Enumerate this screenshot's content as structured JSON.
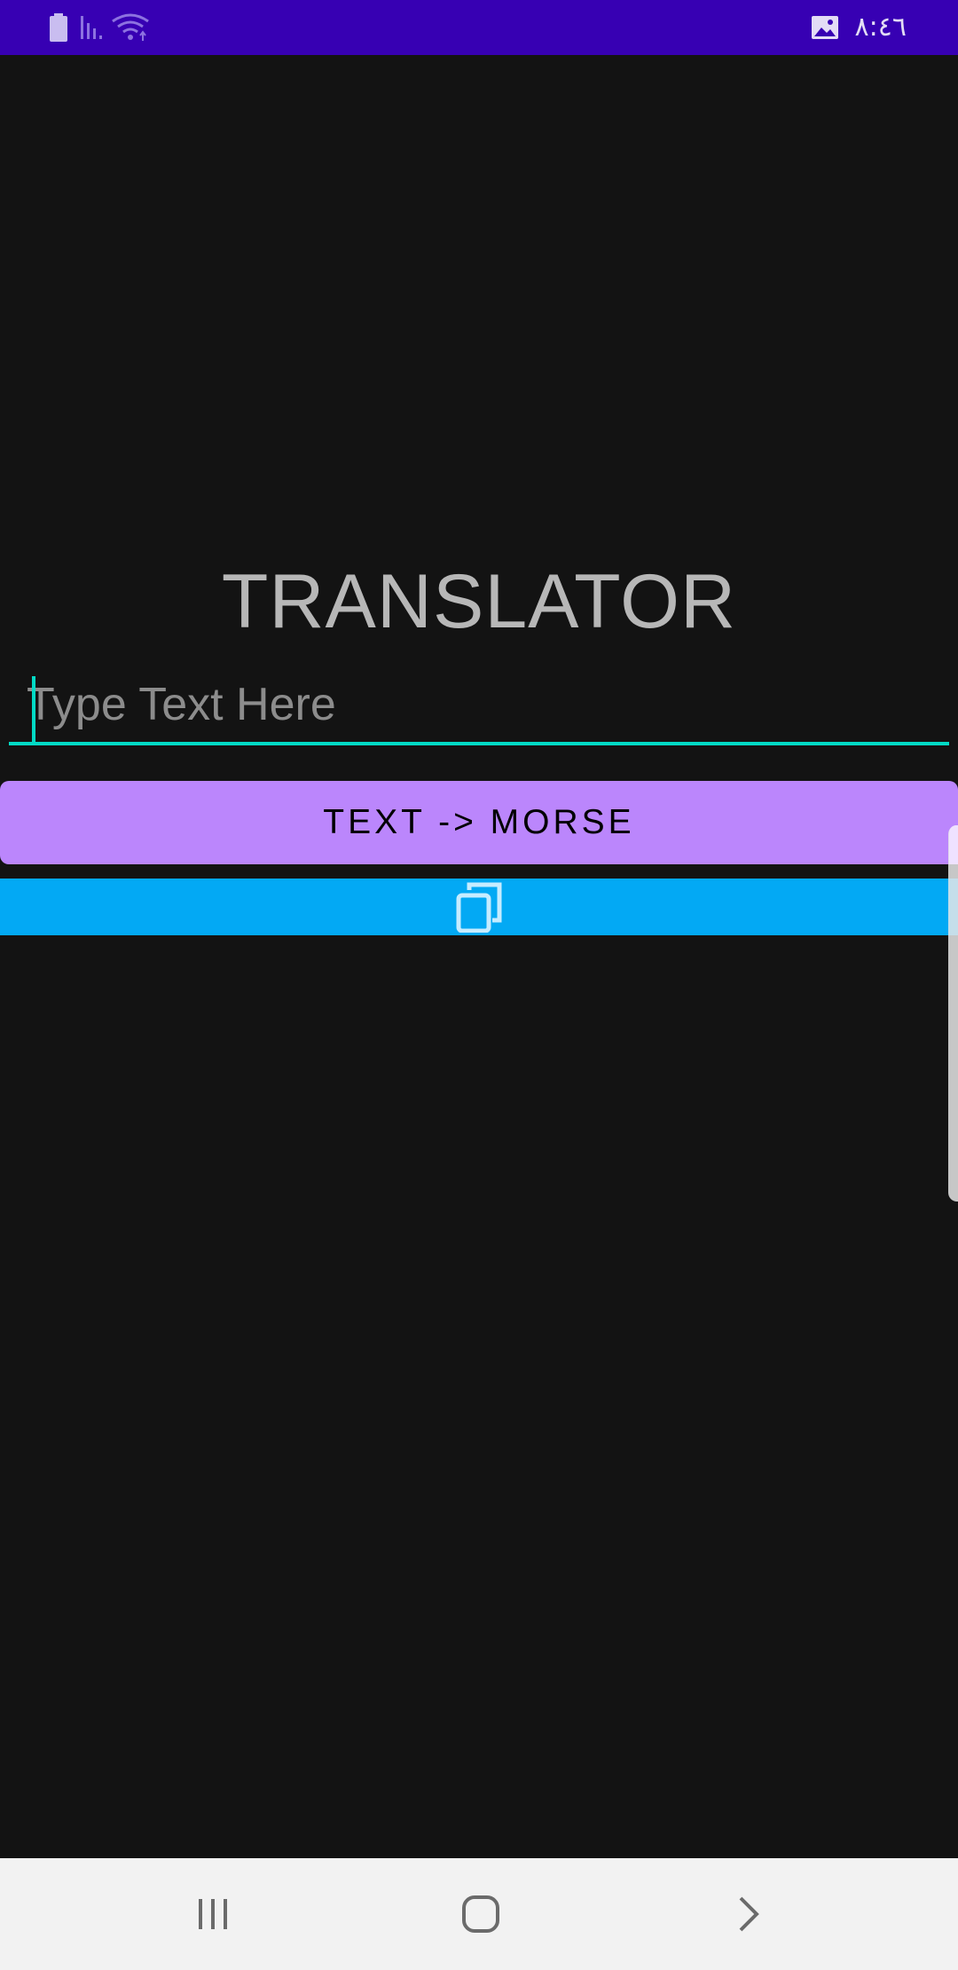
{
  "status_bar": {
    "time": "٨:٤٦",
    "icons": [
      "battery-icon",
      "signal-icon",
      "wifi-icon",
      "gallery-icon"
    ]
  },
  "main": {
    "title": "TRANSLATOR",
    "input": {
      "placeholder": "Type Text Here",
      "value": ""
    },
    "translate_button_label": "TEXT -> MORSE",
    "copy_icon": "copy-icon"
  },
  "nav_bar": {
    "icons": [
      "recent-apps-icon",
      "home-icon",
      "back-icon"
    ]
  },
  "colors": {
    "status_bar": "#3700b3",
    "background": "#131313",
    "accent_teal": "#03dac5",
    "button_purple": "#bb86fc",
    "copy_bar_blue": "#03a9f4",
    "nav_bar": "#f2f2f2"
  }
}
